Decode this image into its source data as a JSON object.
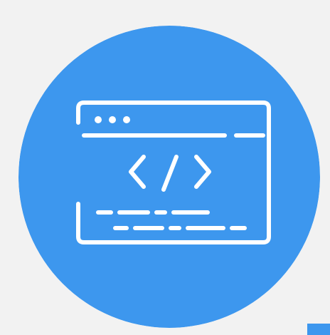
{
  "icon": {
    "name": "code-window-icon",
    "glyph": "</>",
    "background_color": "#3d97ee",
    "line_color": "#ffffff",
    "page_background": "#f2f2f2"
  }
}
